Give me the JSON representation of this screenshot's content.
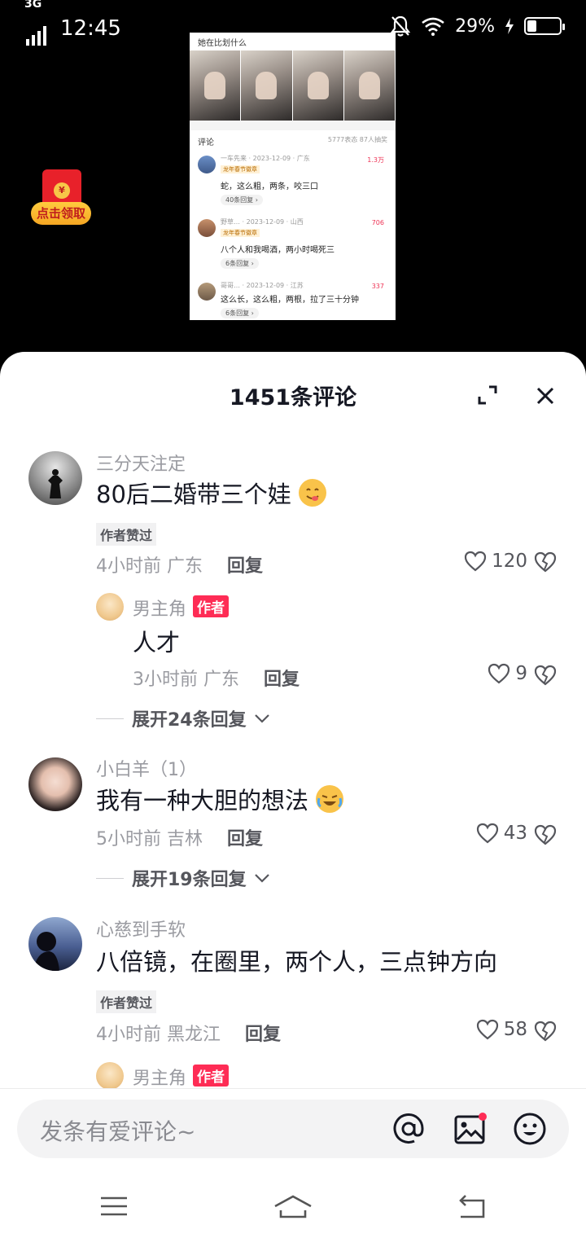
{
  "status_bar": {
    "network": "3G",
    "time": "12:45",
    "battery_pct": "29%",
    "battery_level": 0.29
  },
  "video": {
    "thumb_caption": "她在比划什么",
    "thumb_section": "评论",
    "thumb_stats": "5777表态  87人抽奖",
    "thumb_comments": [
      {
        "name": "一车先来 · 2023-12-09 · 广东",
        "tag": "龙年春节徽章",
        "text": "蛇，这么粗，两条，咬三口",
        "more": "40条回复 ›",
        "likes": "1.3万"
      },
      {
        "name": "野草… · 2023-12-09 · 山西",
        "tag": "龙年春节徽章",
        "text": "八个人和我喝酒，两小时喝死三",
        "more": "6条回复 ›",
        "likes": "706"
      },
      {
        "name": "哥哥… · 2023-12-09 · 江苏",
        "tag": "",
        "text": "这么长，这么粗，两根，拉了三十分钟",
        "more": "6条回复 ›",
        "likes": "337"
      }
    ]
  },
  "redpacket": {
    "label": "点击领取",
    "coin": "¥"
  },
  "sheet": {
    "title": "1451条评论",
    "comments": [
      {
        "name": "三分天注定",
        "text": "80后二婚带三个娃",
        "badge": "作者赞过",
        "time_loc": "4小时前 广东",
        "reply_label": "回复",
        "likes": "120"
      },
      {
        "name": "小白羊（1）",
        "text": "我有一种大胆的想法",
        "time_loc": "5小时前 吉林",
        "reply_label": "回复",
        "likes": "43"
      },
      {
        "name": "心慈到手软",
        "text": "八倍镜，在圈里，两个人，三点钟方向",
        "badge": "作者赞过",
        "time_loc": "4小时前 黑龙江",
        "reply_label": "回复",
        "likes": "58"
      }
    ],
    "replies": [
      {
        "name": "男主角",
        "author_tag": "作者",
        "text": "人才",
        "time_loc": "3小时前 广东",
        "reply_label": "回复",
        "likes": "9"
      },
      {
        "name": "男主角",
        "author_tag": "作者"
      }
    ],
    "expand": [
      "展开24条回复",
      "展开19条回复"
    ]
  },
  "input": {
    "placeholder": "发条有爱评论~"
  },
  "icons": {
    "expand": "expand-icon",
    "close": "close-icon",
    "like": "heart-icon",
    "dislike": "broken-heart-icon",
    "at": "at-icon",
    "image": "image-icon",
    "emoji": "emoji-icon",
    "menu": "menu-icon",
    "home": "home-icon",
    "back": "back-icon"
  },
  "colors": {
    "accent": "#fe2c55",
    "text": "#161823",
    "muted": "#9a9ba1"
  }
}
